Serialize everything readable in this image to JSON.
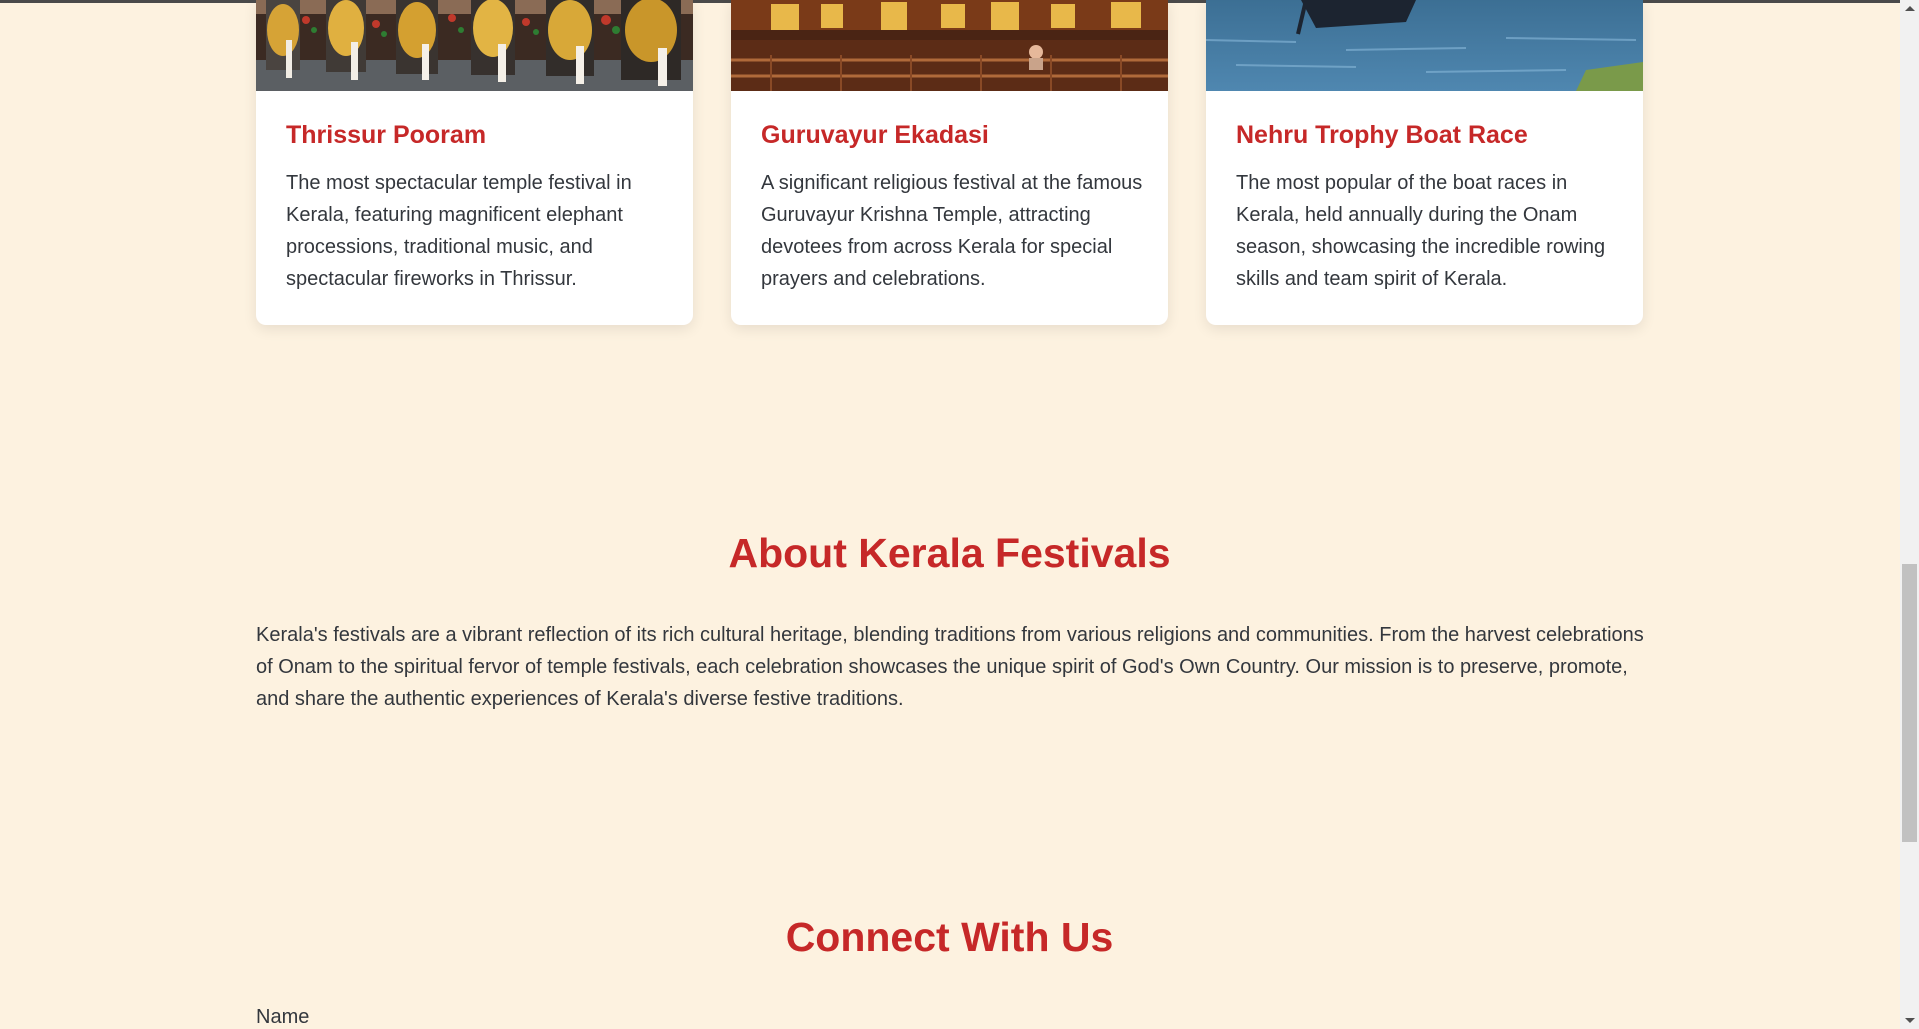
{
  "cards": [
    {
      "title": "Thrissur Pooram",
      "description": "The most spectacular temple festival in Kerala, featuring magnificent elephant processions, traditional music, and spectacular fireworks in Thrissur."
    },
    {
      "title": "Guruvayur Ekadasi",
      "description": "A significant religious festival at the famous Guruvayur Krishna Temple, attracting devotees from across Kerala for special prayers and celebrations."
    },
    {
      "title": "Nehru Trophy Boat Race",
      "description": "The most popular of the boat races in Kerala, held annually during the Onam season, showcasing the incredible rowing skills and team spirit of Kerala."
    }
  ],
  "about": {
    "title": "About Kerala Festivals",
    "text": "Kerala's festivals are a vibrant reflection of its rich cultural heritage, blending traditions from various religions and communities. From the harvest celebrations of Onam to the spiritual fervor of temple festivals, each celebration showcases the unique spirit of God's Own Country. Our mission is to preserve, promote, and share the authentic experiences of Kerala's diverse festive traditions."
  },
  "contact": {
    "title": "Connect With Us",
    "name_label": "Name"
  },
  "colors": {
    "accent": "#c62828",
    "background": "#fdf2e0",
    "text": "#33373d"
  }
}
